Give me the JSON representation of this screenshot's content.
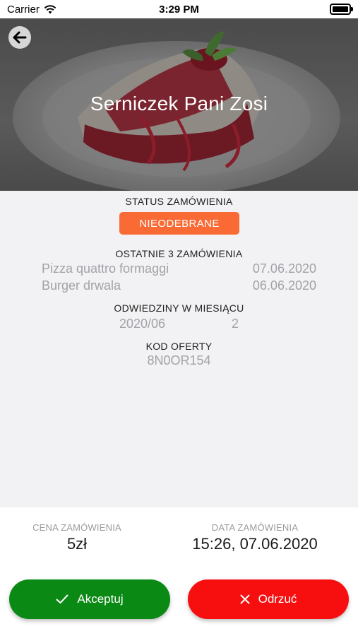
{
  "status_bar": {
    "carrier": "Carrier",
    "time": "3:29 PM"
  },
  "header": {
    "title": "Serniczek Pani Zosi"
  },
  "order": {
    "status_label": "STATUS ZAMÓWIENIA",
    "status_value": "NIEODEBRANE",
    "recent_label": "OSTATNIE 3 ZAMÓWIENIA",
    "recent": [
      {
        "name": "Pizza quattro formaggi",
        "date": "07.06.2020"
      },
      {
        "name": "Burger drwala",
        "date": "06.06.2020"
      }
    ],
    "visits_label": "ODWIEDZINY W MIESIĄCU",
    "visits": {
      "month": "2020/06",
      "count": "2"
    },
    "code_label": "KOD OFERTY",
    "code_value": "8N0OR154"
  },
  "footer": {
    "price_label": "CENA ZAMÓWIENIA",
    "price_value": "5zł",
    "date_label": "DATA ZAMÓWIENIA",
    "date_value": "15:26, 07.06.2020"
  },
  "actions": {
    "accept_label": "Akceptuj",
    "reject_label": "Odrzuć"
  },
  "colors": {
    "accent": "#f96a34",
    "accept": "#0a8a14",
    "reject": "#f70f10"
  }
}
